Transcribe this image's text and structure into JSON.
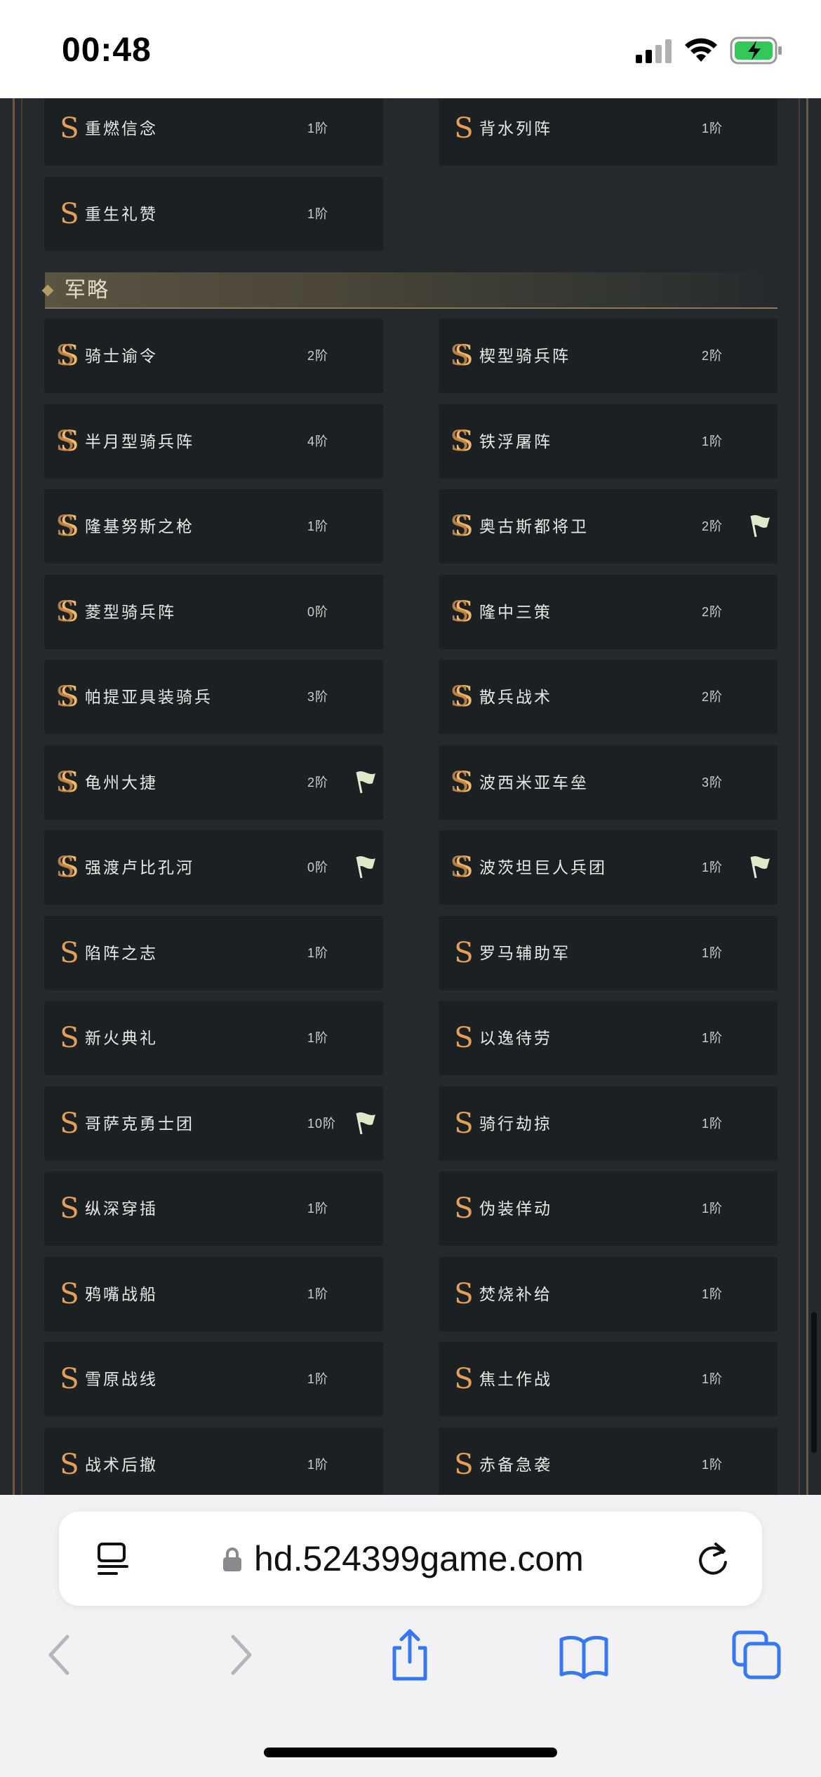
{
  "status_bar": {
    "time": "00:48"
  },
  "section": {
    "title": "军略"
  },
  "top_rows": [
    {
      "left": {
        "name": "重燃信念",
        "rank": "1阶",
        "icon": "s-icon",
        "flag": false
      },
      "right": {
        "name": "背水列阵",
        "rank": "1阶",
        "icon": "s-icon",
        "flag": false
      }
    },
    {
      "left": {
        "name": "重生礼赞",
        "rank": "1阶",
        "icon": "s-icon",
        "flag": false
      },
      "right": null
    }
  ],
  "rows": [
    {
      "left": {
        "name": "骑士谕令",
        "rank": "2阶",
        "icon": "ss-icon",
        "flag": false
      },
      "right": {
        "name": "楔型骑兵阵",
        "rank": "2阶",
        "icon": "ss-icon",
        "flag": false
      }
    },
    {
      "left": {
        "name": "半月型骑兵阵",
        "rank": "4阶",
        "icon": "ss-icon",
        "flag": false
      },
      "right": {
        "name": "铁浮屠阵",
        "rank": "1阶",
        "icon": "ss-icon",
        "flag": false
      }
    },
    {
      "left": {
        "name": "隆基努斯之枪",
        "rank": "1阶",
        "icon": "ss-icon",
        "flag": false
      },
      "right": {
        "name": "奥古斯都将卫",
        "rank": "2阶",
        "icon": "ss-icon",
        "flag": true
      }
    },
    {
      "left": {
        "name": "菱型骑兵阵",
        "rank": "0阶",
        "icon": "ss-icon",
        "flag": false
      },
      "right": {
        "name": "隆中三策",
        "rank": "2阶",
        "icon": "ss-icon",
        "flag": false
      }
    },
    {
      "left": {
        "name": "帕提亚具装骑兵",
        "rank": "3阶",
        "icon": "ss-icon",
        "flag": false
      },
      "right": {
        "name": "散兵战术",
        "rank": "2阶",
        "icon": "ss-icon",
        "flag": false
      }
    },
    {
      "left": {
        "name": "龟州大捷",
        "rank": "2阶",
        "icon": "ss-icon",
        "flag": true
      },
      "right": {
        "name": "波西米亚车垒",
        "rank": "3阶",
        "icon": "ss-icon",
        "flag": false
      }
    },
    {
      "left": {
        "name": "强渡卢比孔河",
        "rank": "0阶",
        "icon": "ss-icon",
        "flag": true
      },
      "right": {
        "name": "波茨坦巨人兵团",
        "rank": "1阶",
        "icon": "ss-icon",
        "flag": true
      }
    },
    {
      "left": {
        "name": "陷阵之志",
        "rank": "1阶",
        "icon": "s-icon",
        "flag": false
      },
      "right": {
        "name": "罗马辅助军",
        "rank": "1阶",
        "icon": "s-icon",
        "flag": false
      }
    },
    {
      "left": {
        "name": "新火典礼",
        "rank": "1阶",
        "icon": "s-icon",
        "flag": false
      },
      "right": {
        "name": "以逸待劳",
        "rank": "1阶",
        "icon": "s-icon",
        "flag": false
      }
    },
    {
      "left": {
        "name": "哥萨克勇士团",
        "rank": "10阶",
        "icon": "s-icon",
        "flag": true
      },
      "right": {
        "name": "骑行劫掠",
        "rank": "1阶",
        "icon": "s-icon",
        "flag": false
      }
    },
    {
      "left": {
        "name": "纵深穿插",
        "rank": "1阶",
        "icon": "s-icon",
        "flag": false
      },
      "right": {
        "name": "伪装佯动",
        "rank": "1阶",
        "icon": "s-icon",
        "flag": false
      }
    },
    {
      "left": {
        "name": "鸦嘴战船",
        "rank": "1阶",
        "icon": "s-icon",
        "flag": false
      },
      "right": {
        "name": "焚烧补给",
        "rank": "1阶",
        "icon": "s-icon",
        "flag": false
      }
    },
    {
      "left": {
        "name": "雪原战线",
        "rank": "1阶",
        "icon": "s-icon",
        "flag": false
      },
      "right": {
        "name": "焦土作战",
        "rank": "1阶",
        "icon": "s-icon",
        "flag": false
      }
    },
    {
      "left": {
        "name": "战术后撤",
        "rank": "1阶",
        "icon": "s-icon",
        "flag": false
      },
      "right": {
        "name": "赤备急袭",
        "rank": "1阶",
        "icon": "s-icon",
        "flag": false
      }
    }
  ],
  "browser": {
    "url": "hd.524399game.com"
  },
  "colors": {
    "accent_orange": "#e79e55",
    "page_bg": "#23292d",
    "card_bg": "#1b2022",
    "ios_blue": "#3478f6"
  }
}
